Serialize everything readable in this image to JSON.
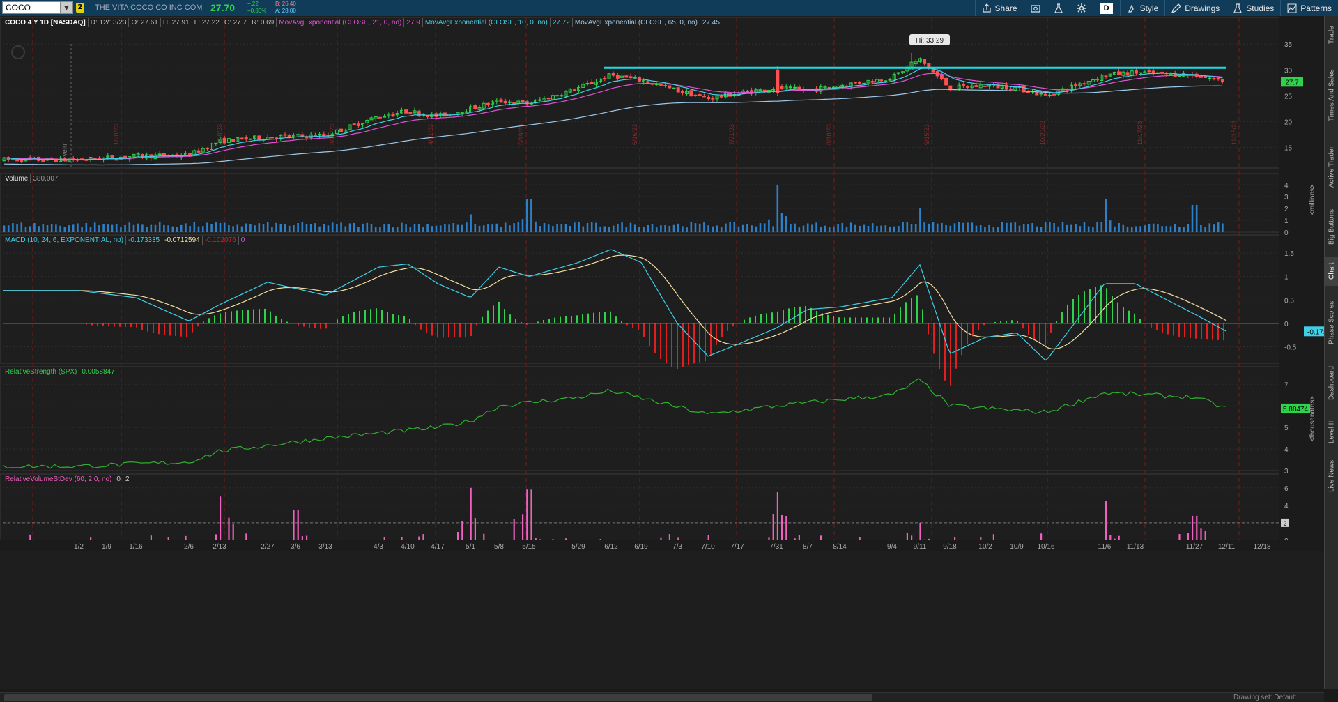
{
  "topbar": {
    "symbol": "COCO",
    "link_badge": "2",
    "company": "THE VITA COCO CO INC COM",
    "last": "27.70",
    "change": "+.22",
    "change_pct": "+0.80%",
    "bid": "B: 26.40",
    "ask": "A: 28.00",
    "buttons": {
      "share": "Share",
      "period": "D",
      "style": "Style",
      "drawings": "Drawings",
      "studies": "Studies",
      "patterns": "Patterns"
    }
  },
  "price_pane": {
    "title": "COCO 4 Y 1D [NASDAQ]",
    "date": "D: 12/13/23",
    "open": "O: 27.61",
    "high": "H: 27.91",
    "low": "L: 27.22",
    "close": "C: 27.7",
    "range": "R: 0.69",
    "ma21_label": "MovAvgExponential (CLOSE, 21, 0, no)",
    "ma21_val": "27.9",
    "ma10_label": "MovAvgExponential (CLOSE, 10, 0, no)",
    "ma10_val": "27.72",
    "ma65_label": "MovAvgExponential (CLOSE, 65, 0, no)",
    "ma65_val": "27.45",
    "hi_label": "Hi: 33.29",
    "price_tag": "27.7",
    "ticks": [
      "35",
      "30",
      "25",
      "20",
      "15"
    ],
    "one_year": "1 year"
  },
  "volume_pane": {
    "title": "Volume",
    "value": "380,007",
    "ticks": [
      "4",
      "3",
      "2",
      "1",
      "0"
    ],
    "unit": "<millions>"
  },
  "macd_pane": {
    "title": "MACD (10, 24, 6, EXPONENTIAL, no)",
    "v1": "-0.173335",
    "v2": "-0.0712594",
    "v3": "-0.102076",
    "v4": "0",
    "ticks": [
      "1.5",
      "1",
      "0.5",
      "0",
      "-0.5"
    ],
    "tag": "-0.1733"
  },
  "rs_pane": {
    "title": "RelativeStrength (SPX)",
    "value": "0.0058847",
    "ticks": [
      "7",
      "6",
      "5",
      "4",
      "3"
    ],
    "tag": "5.88474",
    "unit": "<thousandths>"
  },
  "rv_pane": {
    "title": "RelativeVolumeStDev (60, 2.0, no)",
    "v1": "0",
    "v2": "2",
    "ticks": [
      "6",
      "4",
      "2",
      "0"
    ],
    "tag": "2"
  },
  "x_labels": [
    "1/2",
    "1/9",
    "1/16",
    "2/6",
    "2/13",
    "2/27",
    "3/6",
    "3/13",
    "4/3",
    "4/10",
    "4/17",
    "5/1",
    "5/8",
    "5/15",
    "5/29",
    "6/12",
    "6/19",
    "7/3",
    "7/10",
    "7/17",
    "7/31",
    "8/7",
    "8/14",
    "9/4",
    "9/11",
    "9/18",
    "10/2",
    "10/9",
    "10/16",
    "11/6",
    "11/13",
    "11/27",
    "12/11",
    "12/18"
  ],
  "month_markers": [
    "1/20/23",
    "2/20/23",
    "3/20/23",
    "4/21/23",
    "5/19/23",
    "6/16/23",
    "7/21/23",
    "8/18/23",
    "9/15/23",
    "10/20/23",
    "11/17/23",
    "12/15/23"
  ],
  "right_tabs": [
    "Trade",
    "Times And Sales",
    "Active Trader",
    "Big Buttons",
    "Chart",
    "Phase Scores",
    "Dashboard",
    "Level II",
    "Live News"
  ],
  "footer": {
    "drawing_set": "Drawing set: Default"
  },
  "colors": {
    "up": "#2fd24b",
    "down": "#ff5050",
    "ma21": "#e052d8",
    "ma10": "#3fd0e8",
    "ma65": "#9ec8e8",
    "trendline": "#18dde8",
    "volume": "#2d7fc8",
    "macd": "#3fd0e8",
    "signal": "#f4e0a0",
    "hist_up": "#2fd24b",
    "hist_down": "#e02020",
    "rs": "#2fb02f",
    "rv": "#f060c0"
  },
  "chart_data": [
    {
      "type": "candlestick",
      "title": "COCO 4 Y 1D [NASDAQ]",
      "ylim": [
        11,
        38
      ],
      "series_summary": {
        "start": 12.5,
        "end": 27.7,
        "high": 33.29
      },
      "trendline": {
        "from_x": "6/5",
        "to_x": "12/13",
        "value": 30.4
      },
      "keypoints": [
        {
          "x": "1/2",
          "y": 12.6
        },
        {
          "x": "1/16",
          "y": 13.3
        },
        {
          "x": "2/6",
          "y": 13.5
        },
        {
          "x": "2/13",
          "y": 16.2
        },
        {
          "x": "2/27",
          "y": 17.0
        },
        {
          "x": "3/13",
          "y": 17.3
        },
        {
          "x": "4/3",
          "y": 21.0
        },
        {
          "x": "4/10",
          "y": 22.0
        },
        {
          "x": "4/17",
          "y": 21.0
        },
        {
          "x": "5/1",
          "y": 22.5
        },
        {
          "x": "5/8",
          "y": 24.0
        },
        {
          "x": "5/15",
          "y": 23.5
        },
        {
          "x": "5/29",
          "y": 26.5
        },
        {
          "x": "6/12",
          "y": 29.0
        },
        {
          "x": "6/19",
          "y": 28.0
        },
        {
          "x": "7/3",
          "y": 26.0
        },
        {
          "x": "7/10",
          "y": 24.5
        },
        {
          "x": "7/17",
          "y": 25.5
        },
        {
          "x": "7/31",
          "y": 26.5
        },
        {
          "x": "8/7",
          "y": 26.0
        },
        {
          "x": "8/14",
          "y": 27.0
        },
        {
          "x": "9/4",
          "y": 28.5
        },
        {
          "x": "9/11",
          "y": 32.0
        },
        {
          "x": "9/18",
          "y": 26.5
        },
        {
          "x": "10/2",
          "y": 27.0
        },
        {
          "x": "10/9",
          "y": 26.5
        },
        {
          "x": "10/16",
          "y": 25.0
        },
        {
          "x": "11/6",
          "y": 29.0
        },
        {
          "x": "11/13",
          "y": 29.5
        },
        {
          "x": "11/27",
          "y": 29.0
        },
        {
          "x": "12/11",
          "y": 27.7
        }
      ]
    },
    {
      "type": "bar",
      "title": "Volume",
      "ylim": [
        0,
        4
      ],
      "spikes": [
        {
          "x": "5/1",
          "y": 1.5
        },
        {
          "x": "5/15",
          "y": 2.8
        },
        {
          "x": "7/31",
          "y": 4.0
        },
        {
          "x": "9/11",
          "y": 2.0
        },
        {
          "x": "11/6",
          "y": 2.8
        },
        {
          "x": "11/27",
          "y": 2.3
        }
      ],
      "baseline": 0.4
    },
    {
      "type": "line",
      "title": "MACD (10, 24, 6, EXPONENTIAL, no)",
      "ylim": [
        -0.85,
        1.65
      ],
      "macd": [
        {
          "x": "1/2",
          "y": 0.7
        },
        {
          "x": "1/16",
          "y": 0.55
        },
        {
          "x": "2/6",
          "y": 0.05
        },
        {
          "x": "2/13",
          "y": 0.4
        },
        {
          "x": "2/27",
          "y": 0.88
        },
        {
          "x": "3/13",
          "y": 0.6
        },
        {
          "x": "4/3",
          "y": 1.2
        },
        {
          "x": "4/10",
          "y": 1.27
        },
        {
          "x": "4/17",
          "y": 0.85
        },
        {
          "x": "5/1",
          "y": 0.55
        },
        {
          "x": "5/8",
          "y": 1.2
        },
        {
          "x": "5/15",
          "y": 1.0
        },
        {
          "x": "5/29",
          "y": 1.3
        },
        {
          "x": "6/12",
          "y": 1.58
        },
        {
          "x": "6/19",
          "y": 1.3
        },
        {
          "x": "7/3",
          "y": 0.0
        },
        {
          "x": "7/10",
          "y": -0.7
        },
        {
          "x": "7/17",
          "y": -0.45
        },
        {
          "x": "7/31",
          "y": -0.1
        },
        {
          "x": "8/7",
          "y": 0.3
        },
        {
          "x": "8/14",
          "y": 0.35
        },
        {
          "x": "9/4",
          "y": 0.55
        },
        {
          "x": "9/11",
          "y": 1.25
        },
        {
          "x": "9/18",
          "y": -0.65
        },
        {
          "x": "10/2",
          "y": -0.3
        },
        {
          "x": "10/9",
          "y": -0.2
        },
        {
          "x": "10/16",
          "y": -0.8
        },
        {
          "x": "11/6",
          "y": 0.85
        },
        {
          "x": "11/13",
          "y": 0.85
        },
        {
          "x": "11/27",
          "y": 0.2
        },
        {
          "x": "12/11",
          "y": -0.17
        }
      ]
    },
    {
      "type": "line",
      "title": "RelativeStrength (SPX)",
      "ylim": [
        3,
        7.3
      ],
      "values": [
        {
          "x": "1/2",
          "y": 3.2
        },
        {
          "x": "2/6",
          "y": 3.4
        },
        {
          "x": "2/13",
          "y": 3.9
        },
        {
          "x": "3/13",
          "y": 4.5
        },
        {
          "x": "4/17",
          "y": 5.0
        },
        {
          "x": "5/1",
          "y": 5.3
        },
        {
          "x": "5/8",
          "y": 6.0
        },
        {
          "x": "5/29",
          "y": 6.4
        },
        {
          "x": "6/12",
          "y": 6.7
        },
        {
          "x": "7/10",
          "y": 5.6
        },
        {
          "x": "7/31",
          "y": 6.0
        },
        {
          "x": "8/14",
          "y": 6.3
        },
        {
          "x": "9/4",
          "y": 6.5
        },
        {
          "x": "9/11",
          "y": 7.2
        },
        {
          "x": "9/18",
          "y": 6.0
        },
        {
          "x": "10/16",
          "y": 5.7
        },
        {
          "x": "11/6",
          "y": 6.6
        },
        {
          "x": "11/27",
          "y": 6.4
        },
        {
          "x": "12/11",
          "y": 5.88
        }
      ]
    },
    {
      "type": "bar",
      "title": "RelativeVolumeStDev (60, 2.0, no)",
      "ylim": [
        0,
        6.3
      ],
      "spikes": [
        {
          "x": "2/13",
          "y": 5.0
        },
        {
          "x": "3/6",
          "y": 3.5
        },
        {
          "x": "5/1",
          "y": 6.0
        },
        {
          "x": "5/15",
          "y": 5.8
        },
        {
          "x": "7/31",
          "y": 5.5
        },
        {
          "x": "9/11",
          "y": 2.0
        },
        {
          "x": "11/6",
          "y": 4.5
        },
        {
          "x": "11/27",
          "y": 2.8
        }
      ]
    }
  ]
}
